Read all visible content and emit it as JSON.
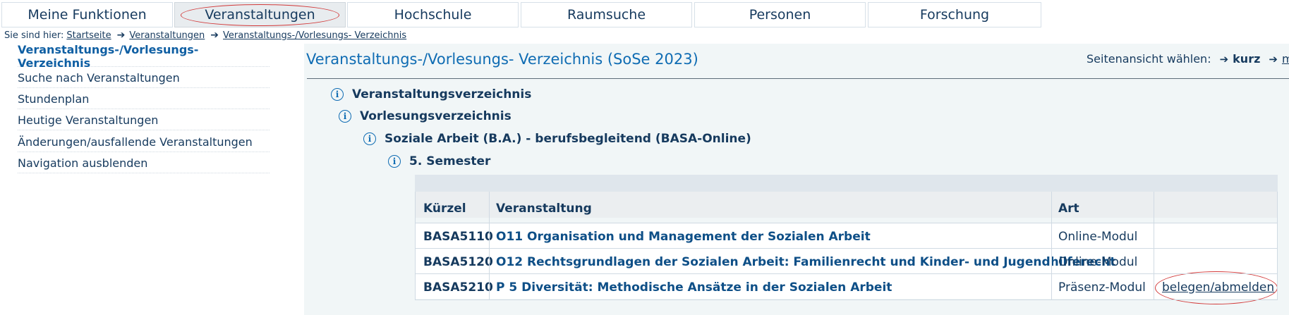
{
  "tabs": [
    {
      "label": "Meine Funktionen",
      "active": false
    },
    {
      "label": "Veranstaltungen",
      "active": true
    },
    {
      "label": "Hochschule",
      "active": false
    },
    {
      "label": "Raumsuche",
      "active": false
    },
    {
      "label": "Personen",
      "active": false
    },
    {
      "label": "Forschung",
      "active": false
    }
  ],
  "breadcrumb": {
    "prefix": "Sie sind hier:",
    "items": [
      "Startseite",
      "Veranstaltungen",
      "Veranstaltungs-/Vorlesungs- Verzeichnis"
    ]
  },
  "sidebar": {
    "items": [
      {
        "label": "Veranstaltungs-/Vorlesungs- Verzeichnis",
        "current": true
      },
      {
        "label": "Suche nach Veranstaltungen"
      },
      {
        "label": "Stundenplan"
      },
      {
        "label": "Heutige Veranstaltungen"
      },
      {
        "label": "Änderungen/ausfallende Veranstaltungen"
      },
      {
        "label": "Navigation ausblenden"
      }
    ]
  },
  "main": {
    "title": "Veranstaltungs-/Vorlesungs- Verzeichnis (SoSe 2023)",
    "view_select": {
      "label": "Seitenansicht wählen:",
      "option_current": "kurz",
      "option_next": "mit"
    },
    "tree": [
      {
        "label": "Veranstaltungsverzeichnis"
      },
      {
        "label": "Vorlesungsverzeichnis"
      },
      {
        "label": "Soziale Arbeit (B.A.) - berufsbegleitend (BASA-Online)"
      },
      {
        "label": "5. Semester"
      }
    ],
    "table": {
      "headers": [
        "Kürzel",
        "Veranstaltung",
        "Art",
        ""
      ],
      "rows": [
        {
          "code": "BASA5110",
          "course": "O11 Organisation und Management der Sozialen Arbeit",
          "art": "Online-Modul",
          "action": ""
        },
        {
          "code": "BASA5120",
          "course": "O12 Rechtsgrundlagen der Sozialen Arbeit: Familienrecht und Kinder- und Jugendhilferecht",
          "art": "Online-Modul",
          "action": ""
        },
        {
          "code": "BASA5210",
          "course": "P 5 Diversität: Methodische Ansätze in der Sozialen Arbeit",
          "art": "Präsenz-Modul",
          "action": "belegen/abmelden"
        }
      ]
    }
  },
  "colors": {
    "accent": "#0f6cb3",
    "text": "#163a5e",
    "highlight": "#d23a3a"
  },
  "icons": {
    "info": "info-icon",
    "arrow": "arrow-right-icon"
  }
}
